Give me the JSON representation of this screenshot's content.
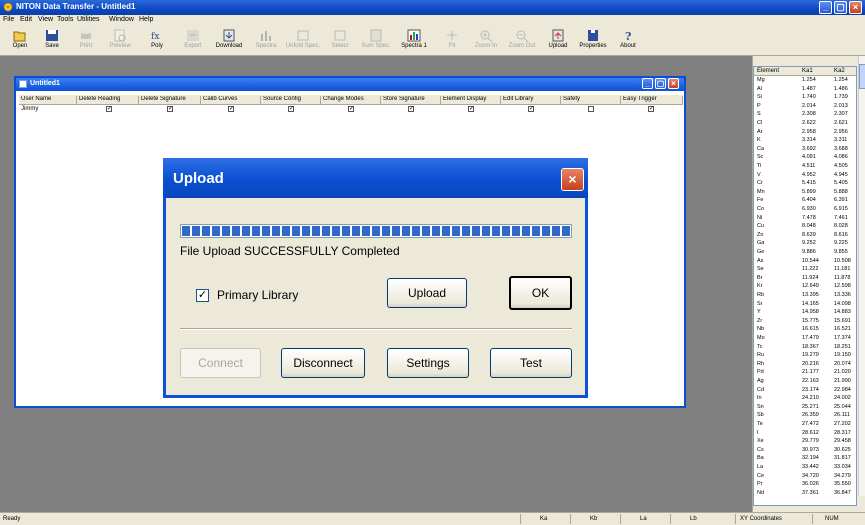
{
  "window": {
    "title": "NITON Data Transfer - Untitled1"
  },
  "menu": [
    "File",
    "Edit",
    "View",
    "Tools",
    "Utilities",
    "Window",
    "Help"
  ],
  "toolbar": [
    {
      "label": "Open",
      "icon": "open-folder-icon",
      "enabled": true
    },
    {
      "label": "Save",
      "icon": "save-disk-icon",
      "enabled": true
    },
    {
      "label": "Print",
      "icon": "print-icon",
      "enabled": false
    },
    {
      "label": "Preview",
      "icon": "preview-icon",
      "enabled": false
    },
    {
      "label": "Poly",
      "icon": "poly-formula-icon",
      "enabled": true
    },
    {
      "label": "Export",
      "icon": "export-icon",
      "enabled": false
    },
    {
      "label": "Download",
      "icon": "download-icon",
      "enabled": true
    },
    {
      "label": "Spectra",
      "icon": "spectra-icon",
      "enabled": false
    },
    {
      "label": "Unfold Spec.",
      "icon": "unfold-spectra-icon",
      "enabled": false
    },
    {
      "label": "Select",
      "icon": "select-icon",
      "enabled": false
    },
    {
      "label": "Sum Spec.",
      "icon": "sum-spectra-icon",
      "enabled": false
    },
    {
      "label": "Spectra 1",
      "icon": "spectra-chart-icon",
      "enabled": true
    },
    {
      "label": "Fit",
      "icon": "fit-icon",
      "enabled": false
    },
    {
      "label": "Zoom In",
      "icon": "zoom-in-icon",
      "enabled": false
    },
    {
      "label": "Zoom Out",
      "icon": "zoom-out-icon",
      "enabled": false
    },
    {
      "label": "Upload",
      "icon": "upload-icon",
      "enabled": true
    },
    {
      "label": "Properties",
      "icon": "properties-icon",
      "enabled": true
    },
    {
      "label": "About",
      "icon": "about-icon",
      "enabled": true
    }
  ],
  "child_window": {
    "title": "Untitled1",
    "columns": [
      "User Name",
      "Delete Reading",
      "Delete Signature",
      "Calib Curves",
      "Source Config",
      "Change Modes",
      "Store Signature",
      "Element Display",
      "Edit Library",
      "Safety",
      "Easy Trigger"
    ],
    "rows": [
      {
        "user": "Jimmy",
        "checks": [
          true,
          true,
          true,
          true,
          true,
          true,
          true,
          true,
          false,
          true
        ]
      }
    ]
  },
  "dialog": {
    "title": "Upload",
    "progress_fraction": 1.0,
    "status": "File Upload SUCCESSFULLY Completed",
    "checkbox_label": "Primary Library",
    "checkbox_checked": true,
    "upload_button": "Upload",
    "ok_button": "OK",
    "connect_button": "Connect",
    "disconnect_button": "Disconnect",
    "settings_button": "Settings",
    "test_button": "Test"
  },
  "element_table": {
    "headers": [
      "Element",
      "Ka1",
      "Ka2"
    ],
    "rows": [
      [
        "Mg",
        "1.254",
        "1.254"
      ],
      [
        "Al",
        "1.487",
        "1.486"
      ],
      [
        "Si",
        "1.740",
        "1.739"
      ],
      [
        "P",
        "2.014",
        "2.013"
      ],
      [
        "S",
        "2.308",
        "2.307"
      ],
      [
        "Cl",
        "2.622",
        "2.621"
      ],
      [
        "Ar",
        "2.958",
        "2.956"
      ],
      [
        "K",
        "3.314",
        "3.311"
      ],
      [
        "Ca",
        "3.692",
        "3.688"
      ],
      [
        "Sc",
        "4.091",
        "4.086"
      ],
      [
        "Ti",
        "4.511",
        "4.505"
      ],
      [
        "V",
        "4.952",
        "4.945"
      ],
      [
        "Cr",
        "5.415",
        "5.405"
      ],
      [
        "Mn",
        "5.899",
        "5.888"
      ],
      [
        "Fe",
        "6.404",
        "6.391"
      ],
      [
        "Co",
        "6.930",
        "6.915"
      ],
      [
        "Ni",
        "7.478",
        "7.461"
      ],
      [
        "Cu",
        "8.048",
        "8.028"
      ],
      [
        "Zn",
        "8.639",
        "8.616"
      ],
      [
        "Ga",
        "9.252",
        "9.225"
      ],
      [
        "Ge",
        "9.886",
        "9.855"
      ],
      [
        "As",
        "10.544",
        "10.508"
      ],
      [
        "Se",
        "11.222",
        "11.181"
      ],
      [
        "Br",
        "11.924",
        "11.878"
      ],
      [
        "Kr",
        "12.649",
        "12.598"
      ],
      [
        "Rb",
        "13.395",
        "13.336"
      ],
      [
        "Sr",
        "14.165",
        "14.098"
      ],
      [
        "Y",
        "14.958",
        "14.883"
      ],
      [
        "Zr",
        "15.775",
        "15.691"
      ],
      [
        "Nb",
        "16.615",
        "16.521"
      ],
      [
        "Mo",
        "17.479",
        "17.374"
      ],
      [
        "Tc",
        "18.367",
        "18.251"
      ],
      [
        "Ru",
        "19.279",
        "19.150"
      ],
      [
        "Rh",
        "20.216",
        "20.074"
      ],
      [
        "Pd",
        "21.177",
        "21.020"
      ],
      [
        "Ag",
        "22.163",
        "21.990"
      ],
      [
        "Cd",
        "23.174",
        "22.984"
      ],
      [
        "In",
        "24.210",
        "24.002"
      ],
      [
        "Sn",
        "25.271",
        "25.044"
      ],
      [
        "Sb",
        "26.359",
        "26.111"
      ],
      [
        "Te",
        "27.472",
        "27.202"
      ],
      [
        "I",
        "28.612",
        "28.317"
      ],
      [
        "Xe",
        "29.779",
        "29.458"
      ],
      [
        "Cs",
        "30.973",
        "30.625"
      ],
      [
        "Ba",
        "32.194",
        "31.817"
      ],
      [
        "La",
        "33.442",
        "33.034"
      ],
      [
        "Ce",
        "34.720",
        "34.279"
      ],
      [
        "Pr",
        "36.026",
        "35.550"
      ],
      [
        "Nd",
        "37.361",
        "36.847"
      ]
    ]
  },
  "statusbar": {
    "left": "Ready",
    "ka": "Ka",
    "kb": "Kb",
    "la": "La",
    "lb": "Lb",
    "coords": "XY Coordinates",
    "num": "NUM"
  }
}
